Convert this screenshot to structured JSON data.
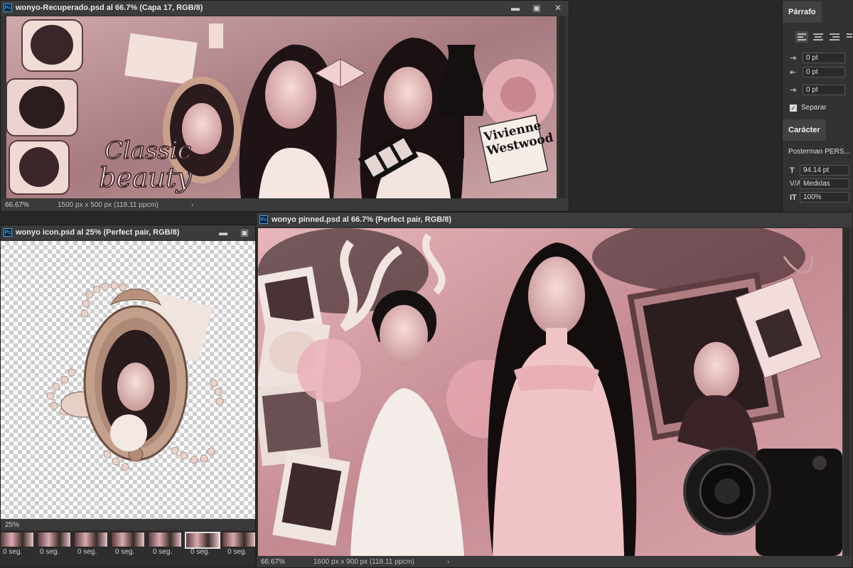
{
  "windows": {
    "recuperado": {
      "title": "wonyo-Recuperado.psd al 66.7% (Capa 17, RGB/8)",
      "zoom": "66.67%",
      "doc_info": "1500 px x 500 px (118.11 ppcm)",
      "art_text_1": "Classic",
      "art_text_2": "beauty",
      "tag_line_1": "Vivienne",
      "tag_line_2": "Westwood"
    },
    "icon": {
      "title": "wonyo icon.psd al 25% (Perfect pair, RGB/8)",
      "zoom": "25%"
    },
    "pinned": {
      "title": "wonyo pinned.psd al 66.7% (Perfect pair, RGB/8)",
      "zoom": "66.67%",
      "doc_info": "1600 px x 900 px (118.11 ppcm)"
    }
  },
  "icons": {
    "ps": "Ps",
    "minimize": "▬",
    "maximize": "▣",
    "close": "✕",
    "chevron": "›"
  },
  "paragraph_panel": {
    "tab": "Párrafo",
    "indent_left": "0 pt",
    "indent_right": "0 pt",
    "indent_first": "0 pt",
    "hyphenate_label": "Separar"
  },
  "character_panel": {
    "tab": "Carácter",
    "font": "Posterman PERS...",
    "size": "94.14 pt",
    "kerning": "Medidas",
    "vertical_scale": "100%"
  },
  "timeline": {
    "delays": [
      "0 seg.",
      "0 seg.",
      "0 seg.",
      "0 seg.",
      "0 seg.",
      "0 seg.",
      "0 seg."
    ]
  },
  "colors": {
    "app_bg": "#282828",
    "panel_bg": "#323232",
    "ps_blue": "#31a8ff",
    "art_pink": "#e8b4b8"
  }
}
